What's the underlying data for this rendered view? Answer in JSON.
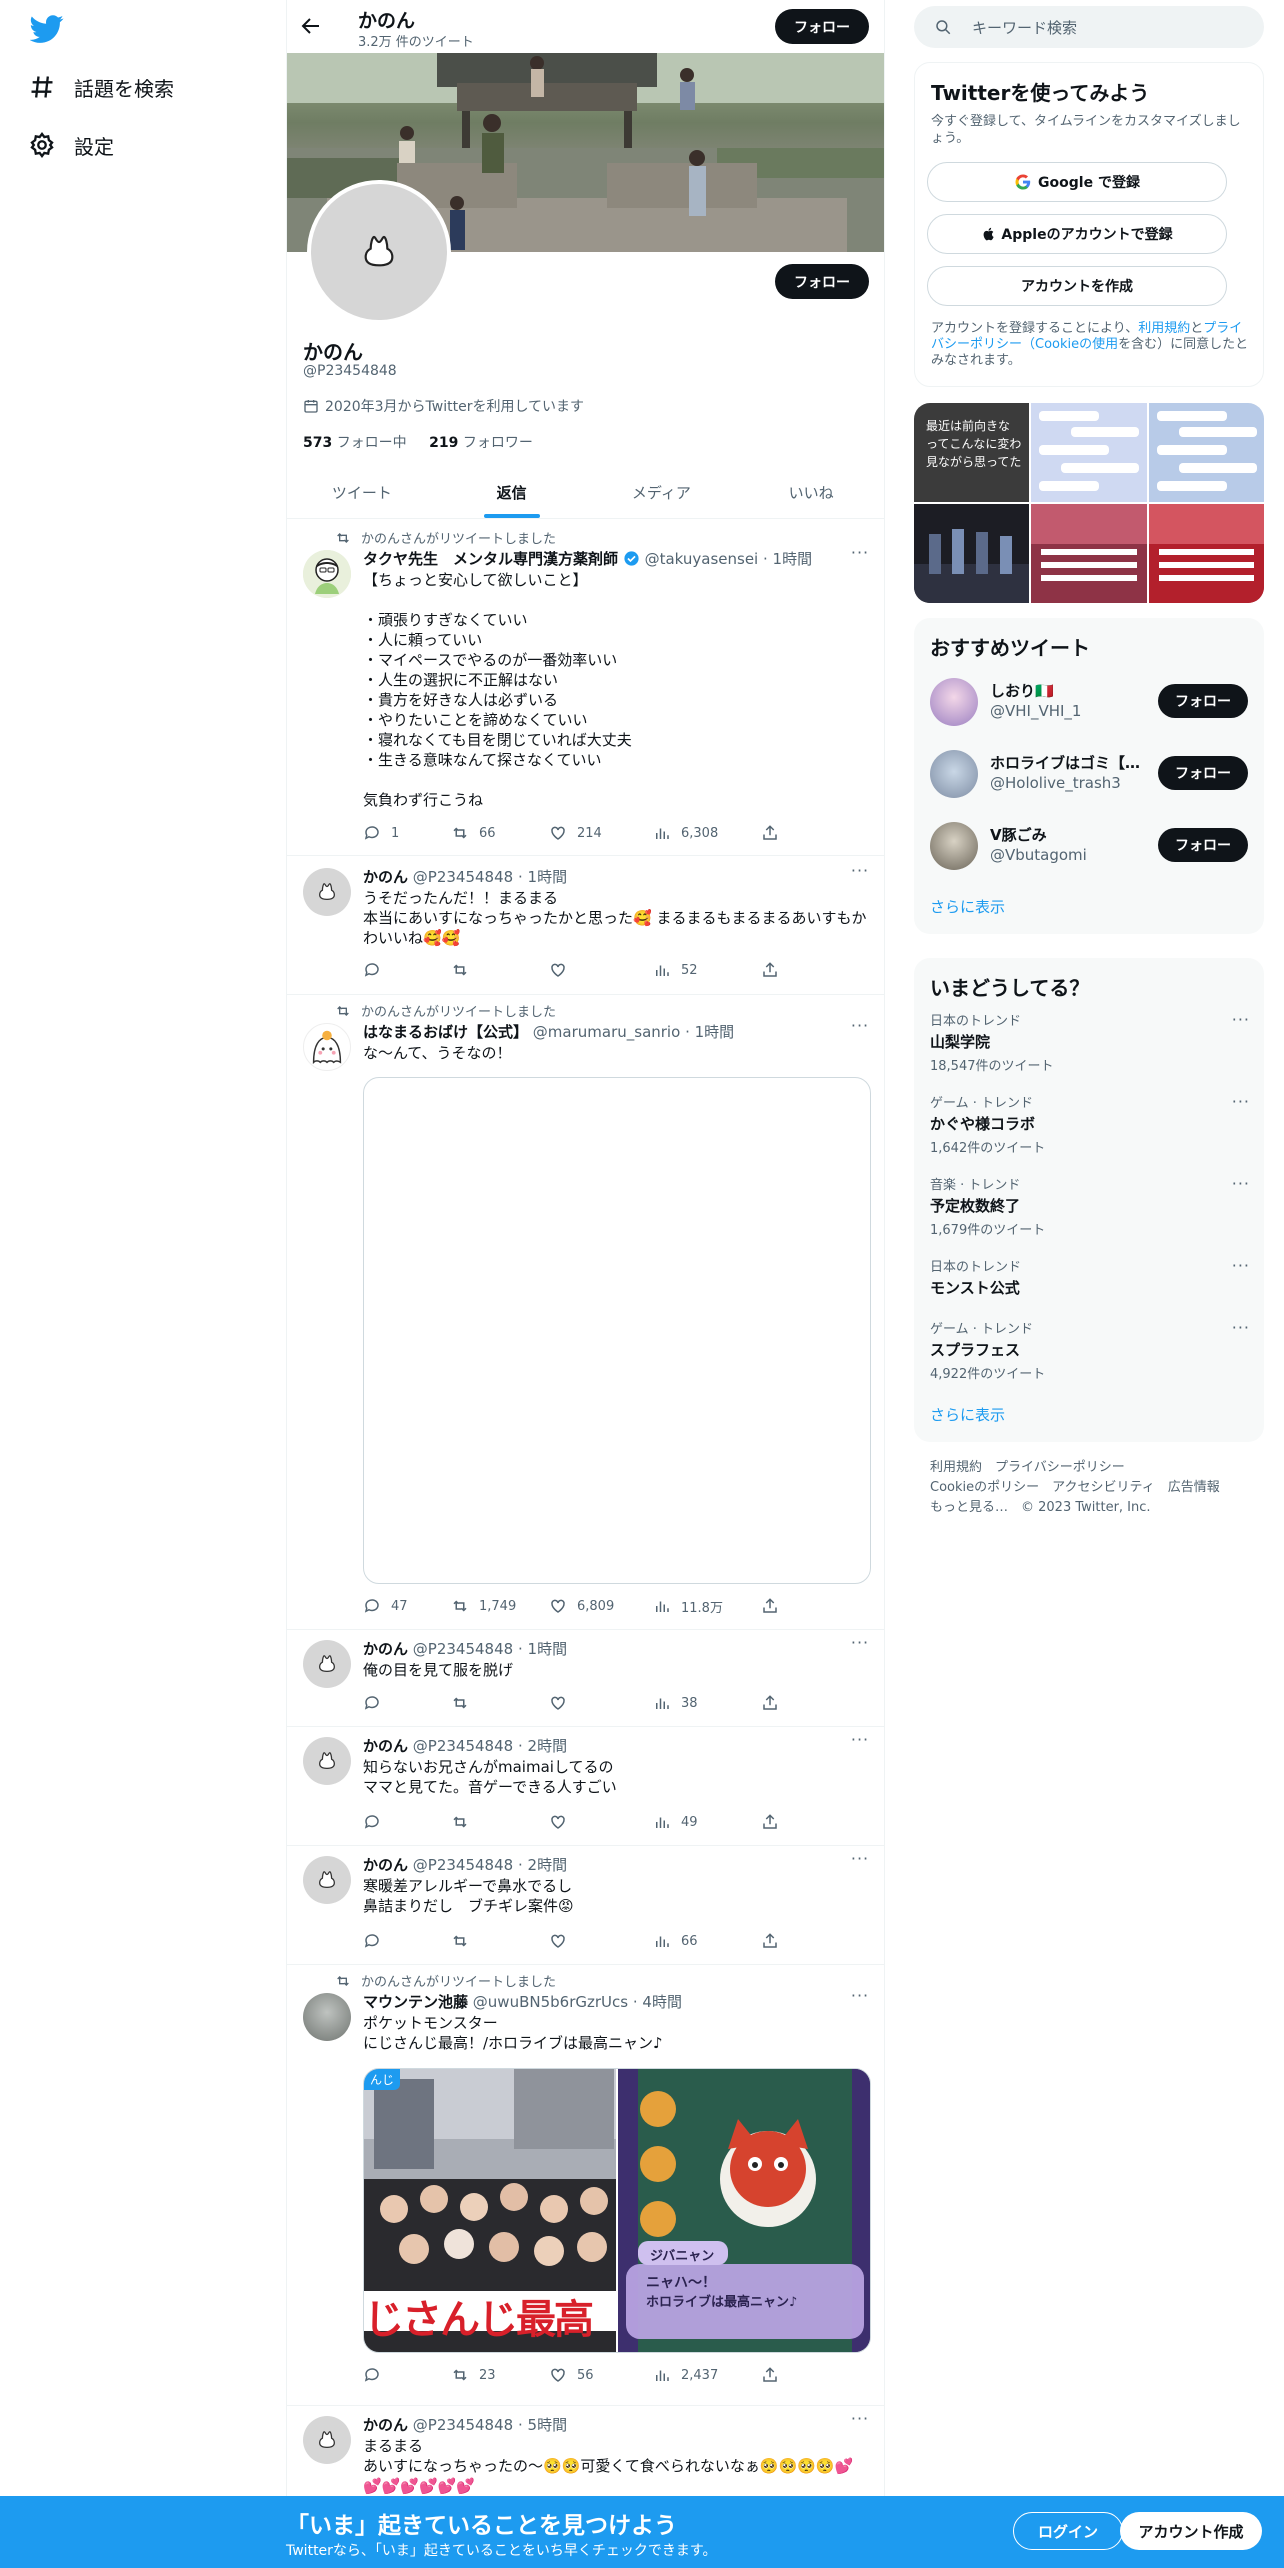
{
  "nav": {
    "explore_label": "話題を検索",
    "settings_label": "設定"
  },
  "profile": {
    "name": "かのん",
    "tweet_count": "3.2万 件のツイート",
    "follow_label": "フォロー",
    "handle": "@P23454848",
    "joined": "2020年3月からTwitterを利用しています",
    "following_count": "573",
    "following_label": "フォロー中",
    "followers_count": "219",
    "followers_label": "フォロワー"
  },
  "tabs": [
    "ツイート",
    "返信",
    "メディア",
    "いいね"
  ],
  "tweets": [
    {
      "retweet_note": "かのんさんがリツイートしました",
      "name": "タクヤ先生　メンタル専門漢方薬剤師",
      "handle": "@takuyasensei",
      "time": "· 1時間",
      "text": "【ちょっと安心して欲しいこと】\n\n・頑張りすぎなくていい\n・人に頼っていい\n・マイペースでやるのが一番効率いい\n・人生の選択に不正解はない\n・貴方を好きな人は必ずいる\n・やりたいことを諦めなくていい\n・寝れなくても目を閉じていれば大丈夫\n・生きる意味なんて探さなくていい\n\n気負わず行こうね",
      "replies": "1",
      "retweets": "66",
      "likes": "214",
      "views": "6,308"
    },
    {
      "name": "かのん",
      "handle": "@P23454848",
      "time": "· 1時間",
      "text": "うそだったんだ！！まるまる\n本当にあいすになっちゃったかと思った🥰 まるまるもまるまるあいすもかわいいね🥰🥰",
      "views": "52"
    },
    {
      "retweet_note": "かのんさんがリツイートしました",
      "name": "はなまるおばけ【公式】",
      "handle": "@marumaru_sanrio",
      "time": "· 1時間",
      "text": "な〜んて、うそなの！",
      "replies": "47",
      "retweets": "1,749",
      "likes": "6,809",
      "views": "11.8万"
    },
    {
      "name": "かのん",
      "handle": "@P23454848",
      "time": "· 1時間",
      "text": "俺の目を見て服を脱げ",
      "views": "38"
    },
    {
      "name": "かのん",
      "handle": "@P23454848",
      "time": "· 2時間",
      "text": "知らないお兄さんがmaimaiしてるの\nママと見てた。音ゲーできる人すごい",
      "views": "49"
    },
    {
      "name": "かのん",
      "handle": "@P23454848",
      "time": "· 2時間",
      "text": "寒暖差アレルギーで鼻水でるし\n鼻詰まりだし　ブチギレ案件😡",
      "views": "66"
    },
    {
      "retweet_note": "かのんさんがリツイートしました",
      "name": "マウンテン池藤",
      "handle": "@uwuBN5b6rGzrUcs",
      "time": "· 4時間",
      "text": "ポケットモンスター\nにじさんじ最高！/ホロライブは最高ニャン♪",
      "replies": "",
      "retweets": "23",
      "likes": "56",
      "views": "2,437",
      "media_left_text": "じさんじ最高",
      "media_left_tag": "んじ",
      "media_right_name": "ジバニャン",
      "media_right_line1": "ニャハ〜！",
      "media_right_line2": "ホロライブは最高ニャン♪"
    },
    {
      "name": "かのん",
      "handle": "@P23454848",
      "time": "· 5時間",
      "text": "まるまる\nあいすになっちゃったの〜🥺🥺可愛くて食べられないなぁ🥺🥺🥺🥺💕\n💕💕💕💕💕💕"
    }
  ],
  "search": {
    "placeholder": "キーワード検索"
  },
  "signup_card": {
    "title": "Twitterを使ってみよう",
    "subtitle": "今すぐ登録して、タイムラインをカスタマイズしましょう。",
    "google": "Google で登録",
    "apple": "Appleのアカウントで登録",
    "create": "アカウントを作成",
    "terms_pre": "アカウントを登録することにより、",
    "terms_link1": "利用規約",
    "terms_mid": "と",
    "terms_link2": "プライバシーポリシー（Cookieの使用",
    "terms_post": "を含む）に同意したとみなされます。"
  },
  "media_thumbs": {
    "t1": "最近は前向きな\nってこんなに変わ\n見ながら思ってた"
  },
  "recommend": {
    "title": "おすすめツイート",
    "users": [
      {
        "name": "しおり🇮🇹",
        "handle": "@VHI_VHI_1",
        "follow": "フォロー"
      },
      {
        "name": "ホロライブはゴミ【…",
        "handle": "@Hololive_trash3",
        "follow": "フォロー"
      },
      {
        "name": "V豚ごみ",
        "handle": "@Vbutagomi",
        "follow": "フォロー"
      }
    ],
    "more": "さらに表示"
  },
  "trends": {
    "title": "いまどうしてる？",
    "items": [
      {
        "context": "日本のトレンド",
        "topic": "山梨学院",
        "count": "18,547件のツイート"
      },
      {
        "context": "ゲーム · トレンド",
        "topic": "かぐや様コラボ",
        "count": "1,642件のツイート"
      },
      {
        "context": "音楽 · トレンド",
        "topic": "予定枚数終了",
        "count": "1,679件のツイート"
      },
      {
        "context": "日本のトレンド",
        "topic": "モンスト公式",
        "count": ""
      },
      {
        "context": "ゲーム · トレンド",
        "topic": "スプラフェス",
        "count": "4,922件のツイート"
      }
    ],
    "more": "さらに表示"
  },
  "footer": {
    "line1": "利用規約　プライバシーポリシー",
    "line2": "Cookieのポリシー　アクセシビリティ　広告情報",
    "line3": "もっと見る…　© 2023 Twitter, Inc."
  },
  "bottom": {
    "title": "「いま」起きていることを見つけよう",
    "subtitle": "Twitterなら、「いま」起きていることをいち早くチェックできます。",
    "login": "ログイン",
    "signup": "アカウント作成"
  },
  "colors": {
    "accent": "#1d9bf0",
    "dark": "#0f1419",
    "muted": "#536471"
  }
}
